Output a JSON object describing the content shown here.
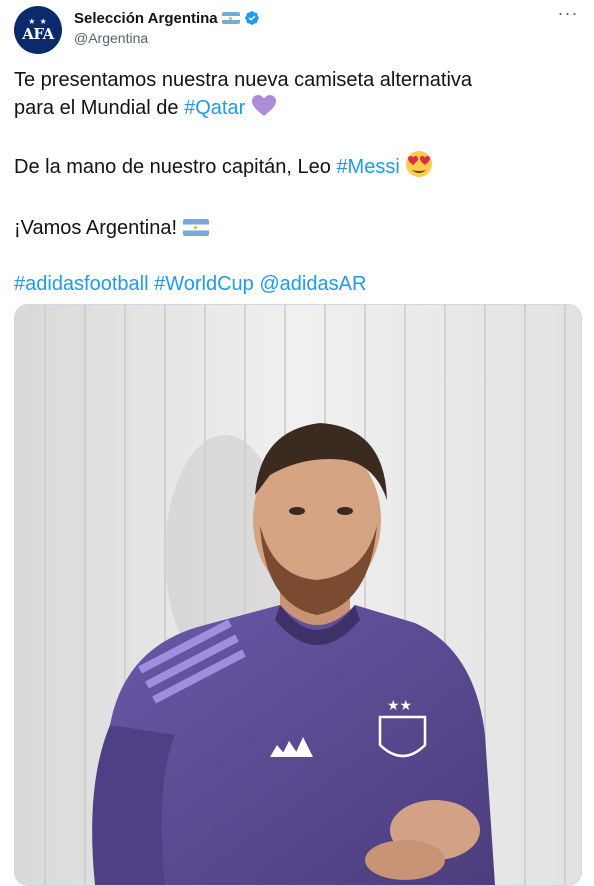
{
  "account": {
    "display_name": "Selección Argentina",
    "handle": "@Argentina",
    "avatar_text": "AFA",
    "avatar_stars": "★ ★"
  },
  "tweet": {
    "line1": "Te presentamos nuestra nueva camiseta alternativa",
    "line2_prefix": "para el Mundial de ",
    "hashtag_qatar": "#Qatar",
    "line3_prefix": "De la mano de nuestro capitán, Leo ",
    "hashtag_messi": "#Messi",
    "line4": "¡Vamos Argentina!",
    "tag_adidas": "#adidasfootball",
    "tag_worldcup": "#WorldCup",
    "mention": "@adidasAR"
  },
  "colors": {
    "link": "#1d9bf0",
    "text": "#0f1419",
    "secondary": "#536471",
    "jersey": "#5a4a8f",
    "verified": "#1d9bf0"
  },
  "icons": {
    "more": "more-dots-icon",
    "verified": "verified-badge-icon",
    "flag": "argentina-flag-emoji",
    "heart": "purple-heart-emoji",
    "heart_eyes": "heart-eyes-emoji"
  }
}
